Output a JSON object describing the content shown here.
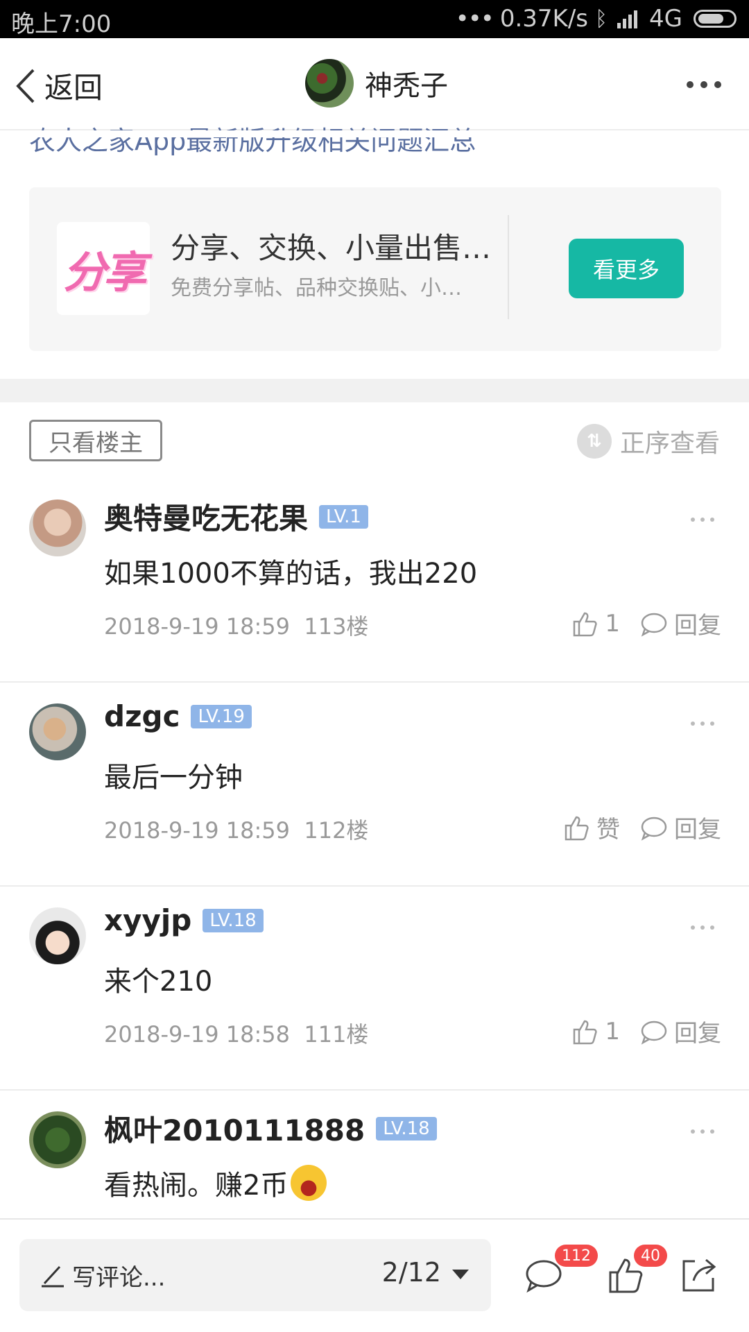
{
  "status_bar": {
    "time": "晚上7:00",
    "network_speed": "0.37K/s",
    "network_type": "4G",
    "icons": [
      "signal-dots-icon",
      "bluetooth-icon",
      "hd-signal-icon",
      "battery-icon"
    ]
  },
  "header": {
    "back_label": "返回",
    "author_name": "神秃子",
    "more_icon": "more-horizontal-icon"
  },
  "cut_link_text": "农人之家App最新版升级相关问题汇总",
  "promo": {
    "logo_text": "分享",
    "title": "分享、交换、小量出售…",
    "subtitle": "免费分享帖、品种交换贴、小…",
    "button_label": "看更多",
    "accent": "#16b8a4"
  },
  "filter": {
    "only_op_label": "只看楼主",
    "sort_label": "正序查看"
  },
  "comments": [
    {
      "name": "奥特曼吃无花果",
      "level": "LV.1",
      "text": "如果1000不算的话，我出220",
      "time": "2018-9-19 18:59",
      "floor": "113楼",
      "likes": "1",
      "reply_label": "回复"
    },
    {
      "name": "dzgc",
      "level": "LV.19",
      "text": "最后一分钟",
      "time": "2018-9-19 18:59",
      "floor": "112楼",
      "likes": "赞",
      "reply_label": "回复"
    },
    {
      "name": "xyyjp",
      "level": "LV.18",
      "text": "来个210",
      "time": "2018-9-19 18:58",
      "floor": "111楼",
      "likes": "1",
      "reply_label": "回复"
    },
    {
      "name": "枫叶2010111888",
      "level": "LV.18",
      "text": "看热闹。赚2币",
      "emoji": "laughing-emoji"
    }
  ],
  "bottom_bar": {
    "write_placeholder": "写评论...",
    "page_indicator": "2/12",
    "comment_count": "112",
    "like_count": "40",
    "badge_color": "#f34a4a"
  }
}
